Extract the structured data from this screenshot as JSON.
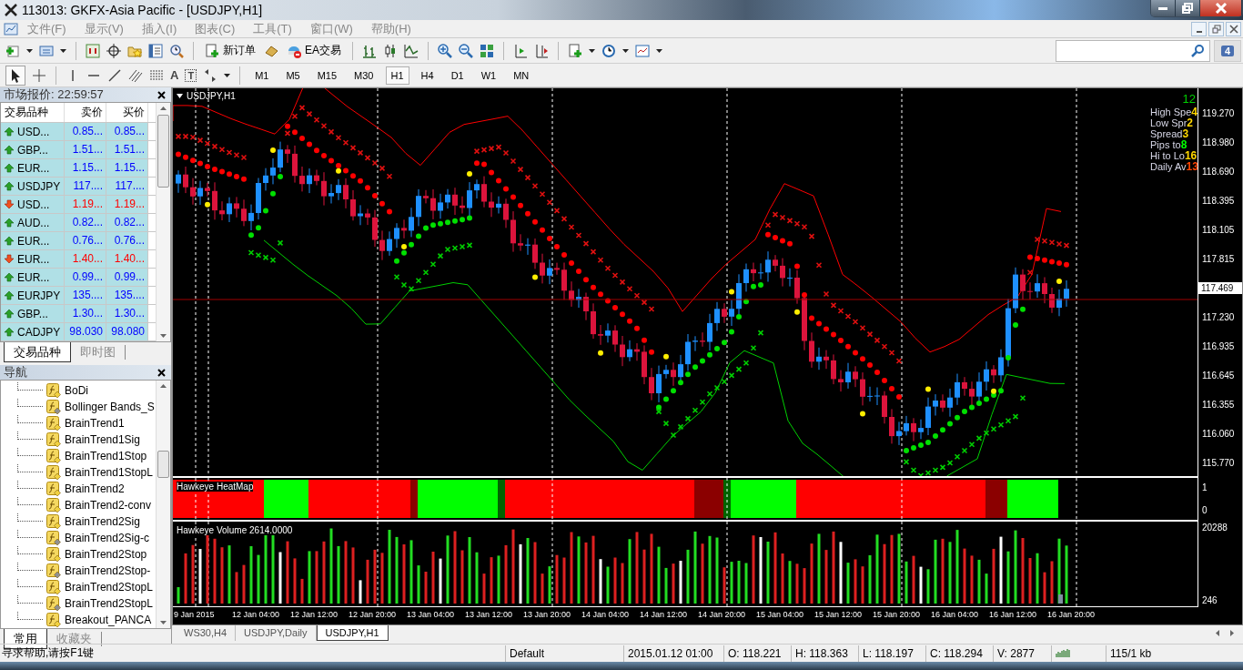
{
  "window": {
    "title": "113013: GKFX-Asia Pacific - [USDJPY,H1]"
  },
  "menu": [
    "文件(F)",
    "显示(V)",
    "插入(I)",
    "图表(C)",
    "工具(T)",
    "窗口(W)",
    "帮助(H)"
  ],
  "toolbar": {
    "new_order": "新订单",
    "expert": "EA交易",
    "notifications": "4"
  },
  "drawing_tools": {
    "text_tool": "A",
    "label_tool": "T"
  },
  "timeframes": [
    {
      "label": "M1",
      "selected": false
    },
    {
      "label": "M5",
      "selected": false
    },
    {
      "label": "M15",
      "selected": false
    },
    {
      "label": "M30",
      "selected": false
    },
    {
      "label": "H1",
      "selected": true
    },
    {
      "label": "H4",
      "selected": false
    },
    {
      "label": "D1",
      "selected": false
    },
    {
      "label": "W1",
      "selected": false
    },
    {
      "label": "MN",
      "selected": false
    }
  ],
  "market_watch": {
    "title": "市场报价: 22:59:57",
    "columns": [
      "交易品种",
      "卖价",
      "买价"
    ],
    "rows": [
      {
        "symbol": "USD...",
        "bid": "0.85...",
        "ask": "0.85...",
        "rising": true
      },
      {
        "symbol": "GBP...",
        "bid": "1.51...",
        "ask": "1.51...",
        "rising": true
      },
      {
        "symbol": "EUR...",
        "bid": "1.15...",
        "ask": "1.15...",
        "rising": true
      },
      {
        "symbol": "USDJPY",
        "bid": "117....",
        "ask": "117....",
        "rising": true
      },
      {
        "symbol": "USD...",
        "bid": "1.19...",
        "ask": "1.19...",
        "rising": false
      },
      {
        "symbol": "AUD...",
        "bid": "0.82...",
        "ask": "0.82...",
        "rising": true
      },
      {
        "symbol": "EUR...",
        "bid": "0.76...",
        "ask": "0.76...",
        "rising": true
      },
      {
        "symbol": "EUR...",
        "bid": "1.40...",
        "ask": "1.40...",
        "rising": false
      },
      {
        "symbol": "EUR...",
        "bid": "0.99...",
        "ask": "0.99...",
        "rising": true
      },
      {
        "symbol": "EURJPY",
        "bid": "135....",
        "ask": "135....",
        "rising": true
      },
      {
        "symbol": "GBP...",
        "bid": "1.30...",
        "ask": "1.30...",
        "rising": true
      },
      {
        "symbol": "CADJPY",
        "bid": "98.030",
        "ask": "98.080",
        "rising": true
      }
    ],
    "tabs": [
      {
        "label": "交易品种",
        "selected": true
      },
      {
        "label": "即时图",
        "selected": false
      }
    ]
  },
  "navigator": {
    "title": "导航",
    "items": [
      {
        "name": "BoDi",
        "kind": "indicator"
      },
      {
        "name": "Bollinger Bands_S",
        "kind": "compiled"
      },
      {
        "name": "BrainTrend1",
        "kind": "indicator"
      },
      {
        "name": "BrainTrend1Sig",
        "kind": "indicator"
      },
      {
        "name": "BrainTrend1Stop",
        "kind": "indicator"
      },
      {
        "name": "BrainTrend1StopL",
        "kind": "indicator"
      },
      {
        "name": "BrainTrend2",
        "kind": "indicator"
      },
      {
        "name": "BrainTrend2-conv",
        "kind": "indicator"
      },
      {
        "name": "BrainTrend2Sig",
        "kind": "indicator"
      },
      {
        "name": "BrainTrend2Sig-c",
        "kind": "compiled"
      },
      {
        "name": "BrainTrend2Stop",
        "kind": "indicator"
      },
      {
        "name": "BrainTrend2Stop-",
        "kind": "compiled"
      },
      {
        "name": "BrainTrend2StopL",
        "kind": "indicator"
      },
      {
        "name": "BrainTrend2StopL",
        "kind": "compiled"
      },
      {
        "name": "Breakout_PANCA",
        "kind": "indicator"
      }
    ],
    "tabs": [
      {
        "label": "常用",
        "selected": true
      },
      {
        "label": "收藏夹",
        "selected": false
      }
    ]
  },
  "chart": {
    "title": "USDJPY,H1",
    "corner_value": "12",
    "info": [
      {
        "label": "High Spe",
        "value": "4",
        "color": "#ffd700"
      },
      {
        "label": "Low Spr",
        "value": "2",
        "color": "#ffd700"
      },
      {
        "label": "Spread",
        "value": "3",
        "color": "#ffd700"
      },
      {
        "label": "Pips to",
        "value": "8",
        "color": "#00ff00"
      },
      {
        "label": "Hi to Lo",
        "value": "16",
        "color": "#ffd700"
      },
      {
        "label": "Daily Av",
        "value": "13",
        "color": "#ff4500"
      }
    ],
    "price_axis": [
      {
        "text": "119.270",
        "kind": "tick"
      },
      {
        "text": "118.980",
        "kind": "tick"
      },
      {
        "text": "118.690",
        "kind": "tick"
      },
      {
        "text": "118.395",
        "kind": "tick"
      },
      {
        "text": "118.105",
        "kind": "tick"
      },
      {
        "text": "117.815",
        "kind": "tick"
      },
      {
        "text": "117.469",
        "kind": "current"
      },
      {
        "text": "117.230",
        "kind": "tick"
      },
      {
        "text": "116.935",
        "kind": "tick"
      },
      {
        "text": "116.645",
        "kind": "tick"
      },
      {
        "text": "116.355",
        "kind": "tick"
      },
      {
        "text": "116.060",
        "kind": "tick"
      },
      {
        "text": "115.770",
        "kind": "tick"
      }
    ],
    "heatmap": {
      "title": "Hawkeye HeatMap",
      "axis": [
        "1",
        "0"
      ]
    },
    "volume": {
      "title": "Hawkeye Volume 2614.0000",
      "axis": [
        "20288",
        "246"
      ]
    },
    "time_axis": [
      "9 Jan 2015",
      "12 Jan 04:00",
      "12 Jan 12:00",
      "12 Jan 20:00",
      "13 Jan 04:00",
      "13 Jan 12:00",
      "13 Jan 20:00",
      "14 Jan 04:00",
      "14 Jan 12:00",
      "14 Jan 20:00",
      "15 Jan 04:00",
      "15 Jan 12:00",
      "15 Jan 20:00",
      "16 Jan 04:00",
      "16 Jan 12:00",
      "16 Jan 20:00"
    ]
  },
  "chart_tabs": [
    {
      "label": "WS30,H4",
      "selected": false
    },
    {
      "label": "USDJPY,Daily",
      "selected": false
    },
    {
      "label": "USDJPY,H1",
      "selected": true
    }
  ],
  "status_bar": {
    "help": "寻求帮助,请按F1键",
    "profile": "Default",
    "time": "2015.01.12 01:00",
    "open": "O: 118.221",
    "high": "H: 118.363",
    "low": "L: 118.197",
    "close": "C: 118.294",
    "volume": "V: 2877",
    "traffic": "115/1 kb"
  }
}
